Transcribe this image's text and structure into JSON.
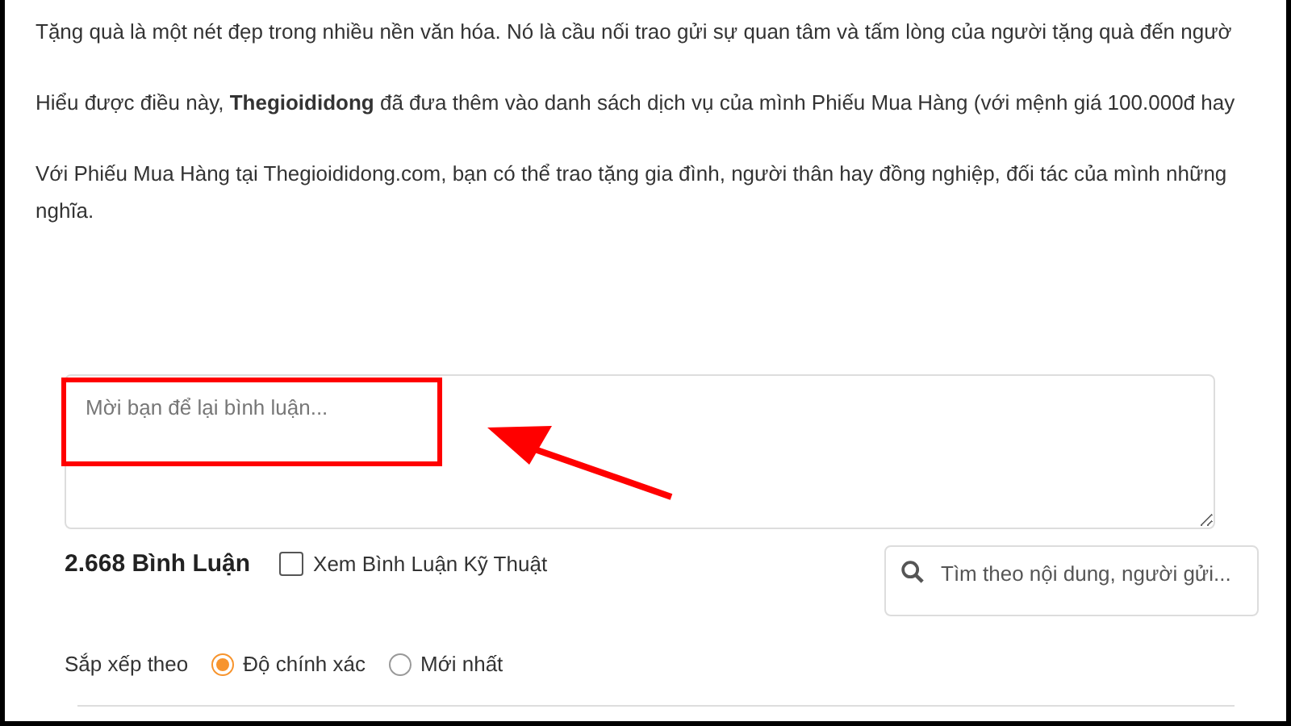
{
  "paragraphs": [
    {
      "lines": [
        "Tặng quà là một nét đẹp trong nhiều nền văn hóa. Nó là cầu nối trao gửi sự quan tâm và tấm lòng của người tặng quà đến ngườ"
      ]
    },
    {
      "lines": [
        "Hiểu được điều này, **Thegioididong** đã đưa thêm vào danh sách dịch vụ của mình Phiếu Mua Hàng (với mệnh giá 100.000đ hay"
      ]
    },
    {
      "lines": [
        "Với Phiếu Mua Hàng tại Thegioididong.com, bạn có thể trao tặng gia đình, người thân hay đồng nghiệp, đối tác của mình những",
        "nghĩa."
      ]
    }
  ],
  "comment_box": {
    "placeholder": "Mời bạn để lại bình luận..."
  },
  "comment_count": "2.668 Bình Luận",
  "tech_filter": {
    "label": "Xem Bình Luận Kỹ Thuật",
    "checked": false
  },
  "search": {
    "placeholder": "Tìm theo nội dung, người gửi..."
  },
  "sort": {
    "label": "Sắp xếp theo",
    "options": [
      {
        "label": "Độ chính xác",
        "selected": true
      },
      {
        "label": "Mới nhất",
        "selected": false
      }
    ]
  }
}
